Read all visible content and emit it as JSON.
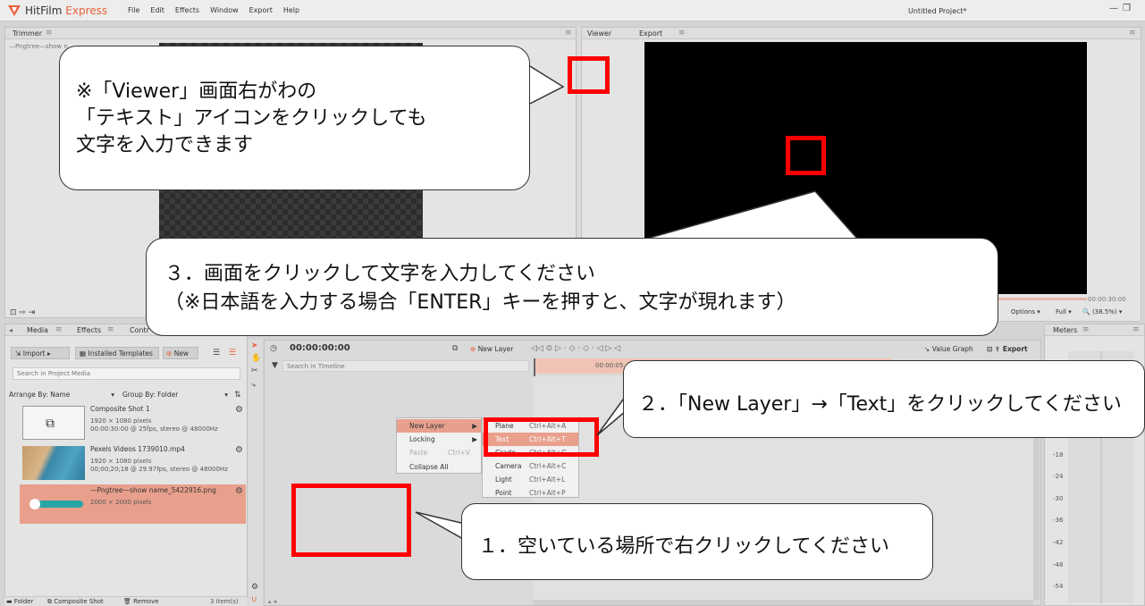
{
  "app": {
    "brand_a": "HitFilm",
    "brand_b": "Express",
    "window_title": "Untitled Project*"
  },
  "menu": [
    "File",
    "Edit",
    "Effects",
    "Window",
    "Export",
    "Help"
  ],
  "trimmer": {
    "tab": "Trimmer",
    "file": "—Pngtree—show n..."
  },
  "viewer": {
    "tab_viewer": "Viewer",
    "tab_export": "Export",
    "timecode": "00:00:30:00",
    "options": "Options",
    "quality": "Full",
    "zoom": "(38.5%)"
  },
  "media": {
    "tab_media": "Media",
    "tab_effects": "Effects",
    "tab_controls": "Contr",
    "import": "Import",
    "installed_templates": "Installed Templates",
    "new": "New",
    "search_placeholder": "Search in Project Media",
    "arrange": "Arrange By: Name",
    "group": "Group By: Folder",
    "items": [
      {
        "name": "Composite Shot 1",
        "line1": "1920 × 1080 pixels",
        "line2": "00:00:30:00 @ 25fps, stereo @ 48000Hz"
      },
      {
        "name": "Pexels Videos 1739010.mp4",
        "line1": "1920 × 1080 pixels",
        "line2": "00;00;20;18 @ 29.97fps, stereo @ 48000Hz"
      },
      {
        "name": "—Pngtree—show name_5422916.png",
        "line1": "2000 × 2000 pixels",
        "line2": ""
      }
    ],
    "footer_folder": "Folder",
    "footer_comp": "Composite Shot",
    "footer_remove": "Remove",
    "footer_count": "3 item(s)"
  },
  "timeline": {
    "timecode": "00:00:00:00",
    "new_layer": "New Layer",
    "search_placeholder": "Search in Timeline",
    "value_graph": "Value Graph",
    "export": "Export",
    "ruler_label": "00:00:05"
  },
  "context_menu": {
    "items": [
      "New Layer",
      "Locking",
      "Paste",
      "Collapse All"
    ],
    "paste_shortcut": "Ctrl+V",
    "submenu": [
      {
        "label": "Plane",
        "shortcut": "Ctrl+Alt+A"
      },
      {
        "label": "Text",
        "shortcut": "Ctrl+Alt+T"
      },
      {
        "label": "Grade",
        "shortcut": "Ctrl+Alt+G"
      },
      {
        "label": "Camera",
        "shortcut": "Ctrl+Alt+C"
      },
      {
        "label": "Light",
        "shortcut": "Ctrl+Alt+L"
      },
      {
        "label": "Point",
        "shortcut": "Ctrl+Alt+P"
      }
    ]
  },
  "meters": {
    "tab": "Meters",
    "labels": [
      "-18",
      "-24",
      "-30",
      "-36",
      "-42",
      "-48",
      "-54"
    ]
  },
  "callouts": {
    "c1_line1": "※「Viewer」画面右がわの",
    "c1_line2": "「テキスト」アイコンをクリックしても",
    "c1_line3": "文字を入力できます",
    "c3_line1": "３．画面をクリックして文字を入力してください",
    "c3_line2": "（※日本語を入力する場合「ENTER」キーを押すと、文字が現れます）",
    "c2": "２．「New Layer」→「Text」をクリックしてください",
    "c1b": "１．空いている場所で右クリックしてください"
  }
}
